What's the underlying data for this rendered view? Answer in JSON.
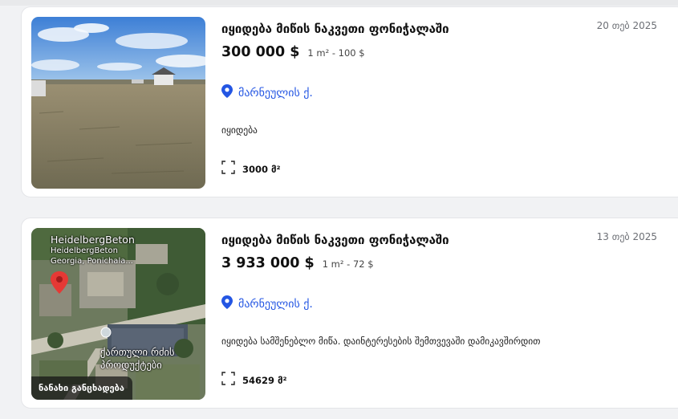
{
  "listings": [
    {
      "title": "იყიდება მიწის ნაკვეთი ფონიჭალაში",
      "date": "20 თებ 2025",
      "price": "300 000 $",
      "price_per_m": "1 m² - 100 $",
      "location": "მარნეულის ქ.",
      "description": "იყიდება",
      "area": "3000 მ²",
      "image": "land-photo"
    },
    {
      "title": "იყიდება მიწის ნაკვეთი ფონიჭალაში",
      "date": "13 თებ 2025",
      "price": "3 933 000 $",
      "price_per_m": "1 m² - 72 $",
      "location": "მარნეულის ქ.",
      "description": "იყიდება სამშენებლო მიწა. დაინტერესების შემთვევაში დამიკავშირდით",
      "area": "54629 მ²",
      "image": "satellite-map",
      "map_labels": {
        "company": "HeidelbergBeton",
        "company_small": "HeidelbergBeton",
        "place": "Georgia, Ponichala...",
        "building": "ქართული რძის",
        "building2": "პროდუქტები"
      },
      "badge": "ნანახი განცხადება"
    }
  ],
  "icons": {
    "location": "map-pin-icon",
    "area": "expand-corners-icon"
  },
  "colors": {
    "accent": "#2456e3",
    "background": "#f1f2f4"
  }
}
